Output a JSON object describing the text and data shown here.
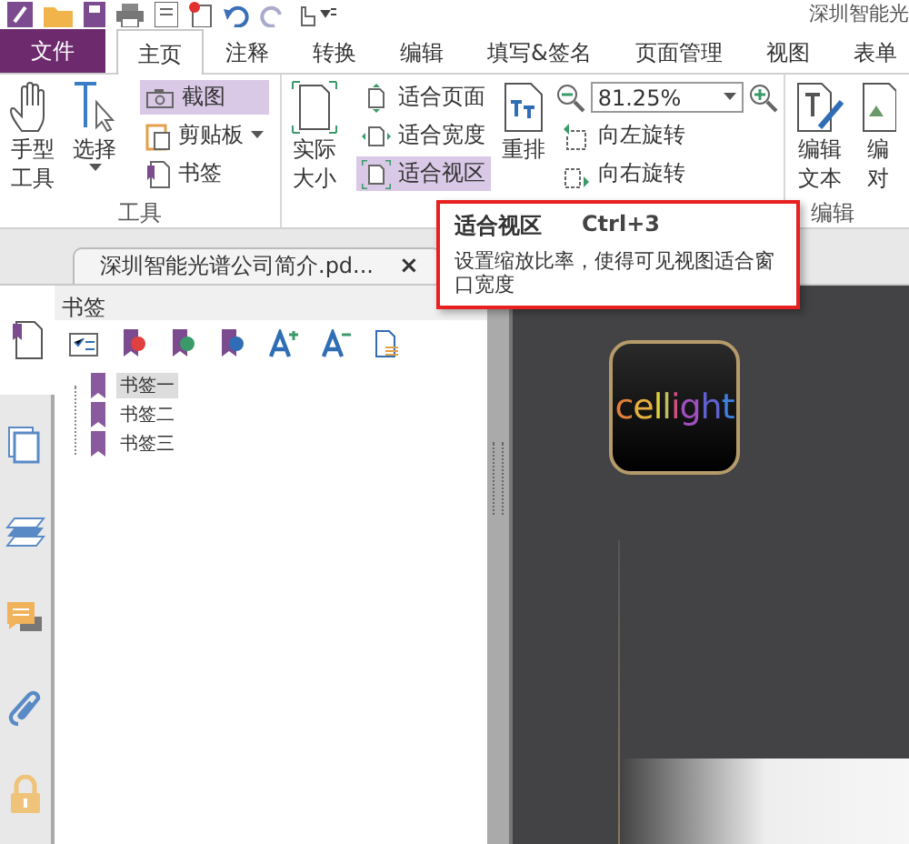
{
  "window": {
    "title": "深圳智能光"
  },
  "tabs": [
    {
      "label": "文件",
      "kind": "file",
      "selected": false
    },
    {
      "label": "主页",
      "kind": "tab",
      "selected": true
    },
    {
      "label": "注释",
      "kind": "tab",
      "selected": false
    },
    {
      "label": "转换",
      "kind": "tab",
      "selected": false
    },
    {
      "label": "编辑",
      "kind": "tab",
      "selected": false
    },
    {
      "label": "填写&签名",
      "kind": "tab",
      "selected": false
    },
    {
      "label": "页面管理",
      "kind": "tab",
      "selected": false
    },
    {
      "label": "视图",
      "kind": "tab",
      "selected": false
    },
    {
      "label": "表单",
      "kind": "tab",
      "selected": false
    }
  ],
  "tools_group": {
    "label": "工具",
    "hand": {
      "lines": [
        "手型",
        "工具"
      ]
    },
    "select": {
      "lines": [
        "选择"
      ]
    },
    "small": [
      {
        "label": "截图",
        "kind": "snapshot",
        "selected": true
      },
      {
        "label": "剪贴板",
        "kind": "clipboard",
        "selected": false
      },
      {
        "label": "书签",
        "kind": "bookmark",
        "selected": false
      }
    ]
  },
  "view_group": {
    "actual_size": {
      "lines": [
        "实际",
        "大小"
      ]
    },
    "fit": [
      {
        "label": "适合页面",
        "kind": "fit-page",
        "selected": false
      },
      {
        "label": "适合宽度",
        "kind": "fit-width",
        "selected": false
      },
      {
        "label": "适合视区",
        "kind": "fit-visible",
        "selected": true
      }
    ],
    "reflow": {
      "lines": [
        "重排"
      ]
    },
    "zoom": {
      "value": "81.25%"
    },
    "rotate": [
      {
        "label": "向左旋转",
        "kind": "left"
      },
      {
        "label": "向右旋转",
        "kind": "right"
      }
    ]
  },
  "edit_group": {
    "label": "编辑",
    "edit_text": {
      "lines": [
        "编辑",
        "文本"
      ]
    },
    "edit_object": {
      "lines": [
        "编",
        "对"
      ]
    }
  },
  "tooltip": {
    "title": "适合视区",
    "shortcut": "Ctrl+3",
    "text": "设置缩放比率，使得可见视图适合窗口宽度"
  },
  "document_tab": {
    "label": "深圳智能光谱公司简介.pd...",
    "close": "×"
  },
  "side_tabs": [
    {
      "kind": "page",
      "selected": true
    },
    {
      "kind": "pages",
      "selected": false
    },
    {
      "kind": "layers",
      "selected": false
    },
    {
      "kind": "comments",
      "selected": false
    },
    {
      "kind": "attachments",
      "selected": false
    },
    {
      "kind": "security",
      "selected": false
    }
  ],
  "bookmarks_panel": {
    "title": "书签",
    "items": [
      {
        "label": "书签一",
        "selected": true
      },
      {
        "label": "书签二",
        "selected": false
      },
      {
        "label": "书签三",
        "selected": false
      }
    ]
  },
  "document": {
    "logo_text": "cellight"
  }
}
